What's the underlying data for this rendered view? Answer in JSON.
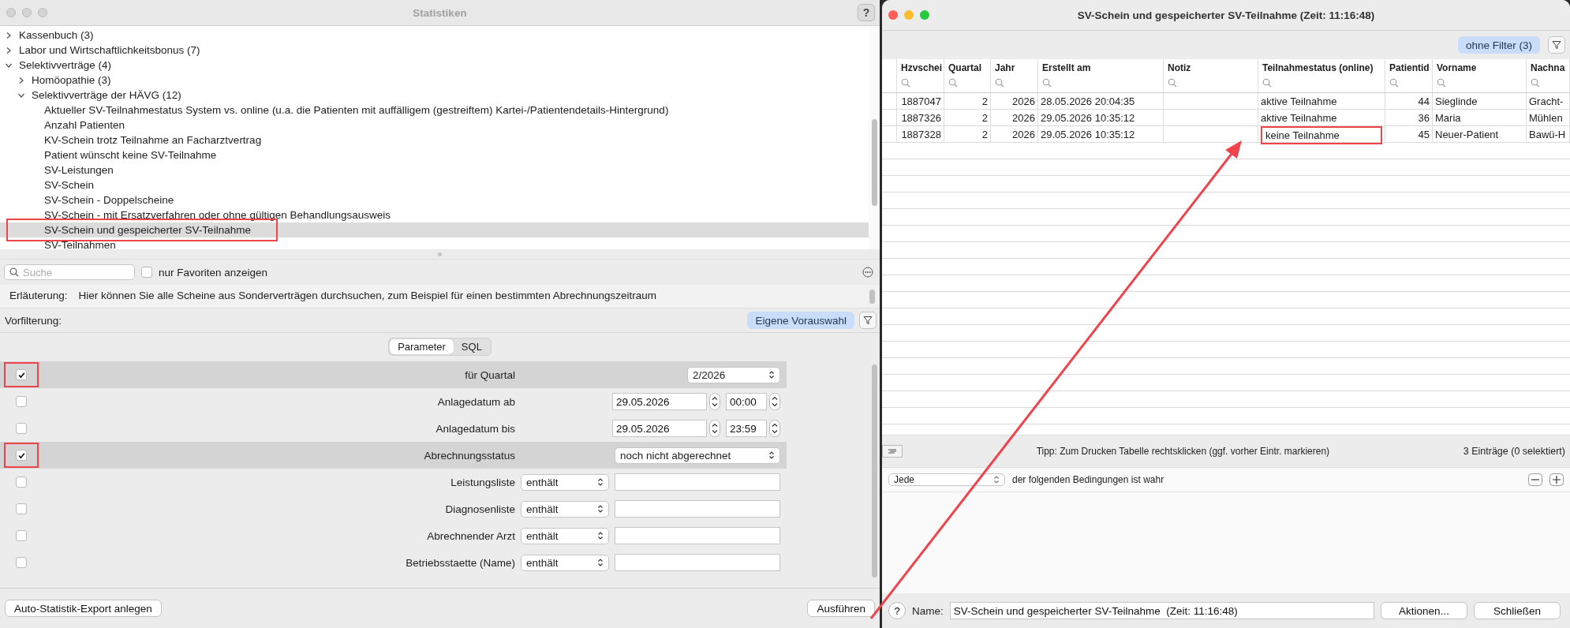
{
  "left_window": {
    "title": "Statistiken",
    "help_button": "?",
    "tree": [
      {
        "label": "Kassenbuch (3)",
        "expanded": false,
        "selected": false
      },
      {
        "label": "Labor und Wirtschaftlichkeitsbonus (7)",
        "expanded": false,
        "selected": false
      },
      {
        "label": "Selektivverträge (4)",
        "expanded": true,
        "selected": false,
        "children": [
          {
            "label": "Homöopathie (3)",
            "expanded": false,
            "selected": false
          },
          {
            "label": "Selektivverträge der HÄVG (12)",
            "expanded": true,
            "selected": false,
            "children": [
              {
                "label": "Aktueller SV-Teilnahmestatus System vs. online (u.a. die Patienten mit auffälligem (gestreiftem) Kartei-/Patientendetails-Hintergrund)",
                "selected": false,
                "annotated": false
              },
              {
                "label": "Anzahl Patienten",
                "selected": false,
                "annotated": false
              },
              {
                "label": "KV-Schein trotz Teilnahme an Facharztvertrag",
                "selected": false,
                "annotated": false
              },
              {
                "label": "Patient wünscht keine SV-Teilnahme",
                "selected": false,
                "annotated": false
              },
              {
                "label": "SV-Leistungen",
                "selected": false,
                "annotated": false
              },
              {
                "label": "SV-Schein",
                "selected": false,
                "annotated": false
              },
              {
                "label": "SV-Schein - Doppelscheine",
                "selected": false,
                "annotated": false
              },
              {
                "label": "SV-Schein - mit Ersatzverfahren oder ohne gültigen Behandlungsausweis",
                "selected": false,
                "annotated": false
              },
              {
                "label": "SV-Schein und gespeicherter SV-Teilnahme",
                "selected": true,
                "annotated": true
              },
              {
                "label": "SV-Teilnahmen",
                "selected": false,
                "annotated": false
              }
            ]
          }
        ]
      }
    ],
    "search": {
      "placeholder": "Suche"
    },
    "favorites": {
      "label": "nur Favoriten anzeigen",
      "checked": false
    },
    "explanation": {
      "label": "Erläuterung:",
      "text": "Hier können Sie alle Scheine aus Sonderverträgen durchsuchen, zum Beispiel für einen bestimmten Abrechnungszeitraum"
    },
    "prefilter": {
      "label": "Vorfilterung:",
      "button": "Eigene Vorauswahl"
    },
    "tabs": [
      {
        "label": "Parameter",
        "selected": true
      },
      {
        "label": "SQL",
        "selected": false
      }
    ],
    "parameters": [
      {
        "kind": "short-select",
        "checked": true,
        "annotated": true,
        "label": "für Quartal",
        "value": "2/2026"
      },
      {
        "kind": "date-time",
        "checked": false,
        "annotated": false,
        "label": "Anlagedatum ab",
        "date": "29.05.2026",
        "time": "00:00"
      },
      {
        "kind": "date-time",
        "checked": false,
        "annotated": false,
        "label": "Anlagedatum bis",
        "date": "29.05.2026",
        "time": "23:59"
      },
      {
        "kind": "select",
        "checked": true,
        "annotated": true,
        "label": "Abrechnungsstatus",
        "value": "noch nicht abgerechnet"
      },
      {
        "kind": "operator-text",
        "checked": false,
        "annotated": false,
        "label": "Leistungsliste",
        "operator": "enthält"
      },
      {
        "kind": "operator-text",
        "checked": false,
        "annotated": false,
        "label": "Diagnosenliste",
        "operator": "enthält"
      },
      {
        "kind": "operator-text",
        "checked": false,
        "annotated": false,
        "label": "Abrechnender Arzt",
        "operator": "enthält"
      },
      {
        "kind": "operator-text",
        "checked": false,
        "annotated": false,
        "label": "Betriebsstaette (Name)",
        "operator": "enthält"
      }
    ],
    "export_button": "Auto-Statistik-Export anlegen",
    "run_button": "Ausführen"
  },
  "right_window": {
    "title": "SV-Schein und gespeicherter SV-Teilnahme  (Zeit: 11:16:48)",
    "filter_button": "ohne Filter (3)",
    "table": {
      "columns": [
        {
          "label": "Hzvschei",
          "marked": false
        },
        {
          "label": "Quartal",
          "marked": false
        },
        {
          "label": "Jahr",
          "marked": false
        },
        {
          "label": "Erstellt am",
          "marked": false
        },
        {
          "label": "Notiz",
          "marked": false
        },
        {
          "label": "Teilnahmestatus (online)",
          "marked": true
        },
        {
          "label": "Patientid",
          "marked": false
        },
        {
          "label": "Vorname",
          "marked": false
        },
        {
          "label": "Nachna",
          "marked": false
        }
      ],
      "rows": [
        {
          "marked": false,
          "cells": [
            "1887047",
            "2",
            "2026",
            "28.05.2026 20:04:35",
            "",
            "aktive Teilnahme",
            "44",
            "Sieglinde",
            "Gracht-"
          ]
        },
        {
          "marked": false,
          "cells": [
            "1887326",
            "2",
            "2026",
            "29.05.2026 10:35:12",
            "",
            "aktive Teilnahme",
            "36",
            "Maria",
            "Mühlen"
          ]
        },
        {
          "marked": true,
          "cells": [
            "1887328",
            "2",
            "2026",
            "29.05.2026 10:35:12",
            "",
            "keine Teilnahme",
            "45",
            "Neuer-Patient",
            "Bawü-H"
          ]
        }
      ]
    },
    "tip": "Tipp: Zum Drucken Tabelle rechtsklicken (ggf. vorher Eintr. markieren)",
    "count": "3 Einträge (0 selektiert)",
    "condition": {
      "match": "Jede",
      "text": "der folgenden Bedingungen ist wahr"
    },
    "help_button": "?",
    "name_field": {
      "label": "Name:",
      "value": "SV-Schein und gespeicherter SV-Teilnahme  (Zeit: 11:16:48)"
    },
    "buttons": [
      "Aktionen...",
      "Schließen"
    ]
  },
  "annotation_arrow": true
}
